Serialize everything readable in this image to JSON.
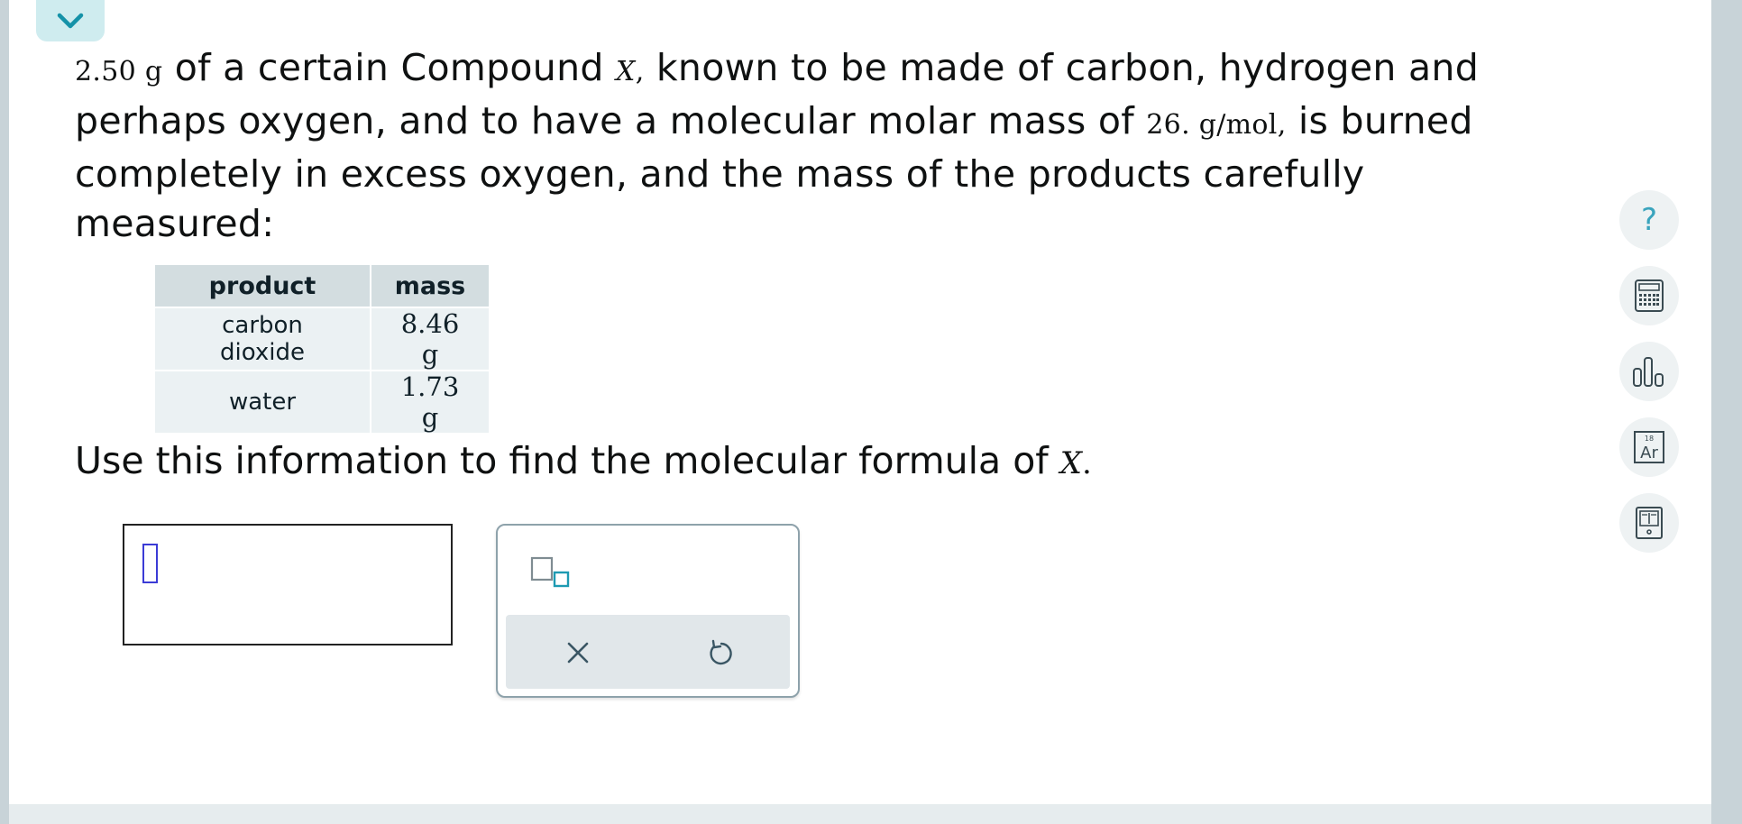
{
  "colors": {
    "accent": "#3aa4bd",
    "tab_bg": "#cfecef",
    "caret": "#3b3bd6"
  },
  "question": {
    "mass_value": "2.50",
    "mass_unit": "g",
    "text_1": " of a certain Compound ",
    "compound_symbol": "X",
    "comma": ",",
    "text_2": " known to be made of carbon, hydrogen and perhaps oxygen, and to have a molecular molar mass of ",
    "molar_mass_value": "26.",
    "molar_mass_unit": "g/mol",
    "text_3": " is burned completely in excess oxygen, and the mass of the products carefully measured:"
  },
  "table": {
    "headers": [
      "product",
      "mass"
    ],
    "rows": [
      {
        "product": "carbon dioxide",
        "mass": "8.46",
        "unit": "g"
      },
      {
        "product": "water",
        "mass": "1.73",
        "unit": "g"
      }
    ]
  },
  "prompt": {
    "text": "Use this information to find the molecular formula of ",
    "symbol": "X",
    "period": "."
  },
  "answer": {
    "value": ""
  },
  "tools": {
    "subscript_icon": "subscript-template-icon",
    "clear_icon": "close-icon",
    "undo_icon": "undo-icon"
  },
  "side_tools": [
    {
      "icon": "help-icon",
      "label": "?"
    },
    {
      "icon": "calculator-icon"
    },
    {
      "icon": "bar-chart-icon"
    },
    {
      "icon": "periodic-table-icon",
      "number": "18",
      "symbol": "Ar"
    },
    {
      "icon": "reference-book-icon"
    }
  ]
}
